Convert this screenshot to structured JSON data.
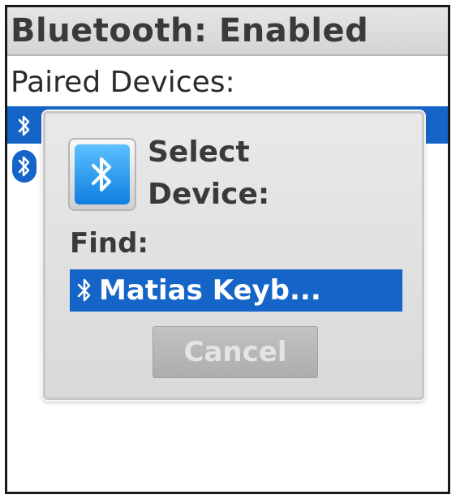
{
  "header": {
    "title": "Bluetooth: Enabled"
  },
  "paired_devices": {
    "label": "Paired Devices:",
    "items": [
      {
        "icon": "bluetooth-icon",
        "selected": true
      },
      {
        "icon": "bluetooth-icon",
        "selected": false
      }
    ]
  },
  "dialog": {
    "icon": "bluetooth-icon",
    "title": "Select Device:",
    "find_label": "Find:",
    "found_device": "Matias Keyb...",
    "cancel_label": "Cancel"
  },
  "colors": {
    "selection": "#1565c8",
    "header_text": "#3a3a3a",
    "dialog_background": "#e0e0e0",
    "cancel_disabled": "#b8b8b8"
  }
}
